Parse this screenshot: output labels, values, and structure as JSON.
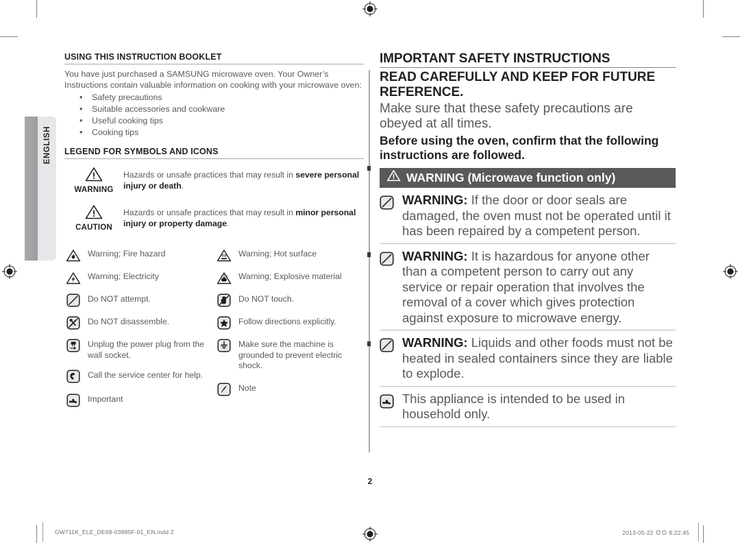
{
  "document": {
    "language_tab": "ENGLISH",
    "page_number": "2",
    "footer_file": "GW711K_ELE_DE68-03895F-01_EN.indd   2",
    "footer_timestamp": "2013-05-22   ＯＯ 8:22:45"
  },
  "left_column": {
    "section1": {
      "heading": "USING THIS INSTRUCTION BOOKLET",
      "paragraph": "You have just purchased a SAMSUNG microwave oven. Your Owner’s Instructions contain valuable information on cooking with your microwave oven:",
      "bullets": [
        "Safety precautions",
        "Suitable accessories and cookware",
        "Useful cooking tips",
        "Cooking tips"
      ]
    },
    "section2": {
      "heading": "LEGEND FOR SYMBOLS AND ICONS",
      "legend_rows": [
        {
          "icon": "warning-triangle-icon",
          "key": "WARNING",
          "text_plain": "Hazards or unsafe practices that may result in ",
          "text_bold": "severe personal injury or death",
          "text_tail": "."
        },
        {
          "icon": "caution-triangle-icon",
          "key": "CAUTION",
          "text_plain": "Hazards or unsafe practices that may result in ",
          "text_bold": "minor personal injury or property damage",
          "text_tail": "."
        }
      ],
      "icons_left": [
        {
          "icon": "fire-hazard-icon",
          "label": "Warning; Fire hazard"
        },
        {
          "icon": "electricity-hazard-icon",
          "label": "Warning; Electricity"
        },
        {
          "icon": "do-not-attempt-icon",
          "label": "Do NOT attempt."
        },
        {
          "icon": "do-not-disassemble-icon",
          "label": "Do NOT disassemble."
        },
        {
          "icon": "unplug-power-icon",
          "label": "Unplug the power plug from the wall socket."
        },
        {
          "icon": "call-service-center-icon",
          "label": "Call the service center for help."
        },
        {
          "icon": "important-hand-icon",
          "label": "Important"
        }
      ],
      "icons_right": [
        {
          "icon": "hot-surface-icon",
          "label": "Warning; Hot surface"
        },
        {
          "icon": "explosive-material-icon",
          "label": "Warning; Explosive material"
        },
        {
          "icon": "do-not-touch-icon",
          "label": "Do NOT touch."
        },
        {
          "icon": "follow-directions-icon",
          "label": "Follow directions explicitly."
        },
        {
          "icon": "grounding-icon",
          "label": "Make sure the machine is grounded to prevent electric shock."
        },
        {
          "icon": "note-pen-icon",
          "label": "Note"
        }
      ]
    }
  },
  "right_column": {
    "title": "IMPORTANT SAFETY INSTRUCTIONS",
    "subtitle": "READ CAREFULLY AND KEEP FOR FUTURE REFERENCE.",
    "plain_line": "Make sure that these safety precautions are obeyed at all times.",
    "bold_line": "Before using the oven, confirm that the following instructions are followed.",
    "warning_bar": {
      "icon": "warning-triangle-icon",
      "label": "WARNING (Microwave function only)"
    },
    "warnings": [
      {
        "icon": "do-not-attempt-icon",
        "lead": "WARNING:",
        "text": " If the door or door seals are damaged, the oven must not be operated until it has been repaired by a competent person."
      },
      {
        "icon": "do-not-attempt-icon",
        "lead": "WARNING:",
        "text": " It is hazardous for anyone other than a competent person to carry out any service or repair operation that involves the removal of a cover which gives protection against exposure to microwave energy."
      },
      {
        "icon": "do-not-attempt-icon",
        "lead": "WARNING:",
        "text": " Liquids and other foods must not be heated in sealed containers since they are liable to explode."
      },
      {
        "icon": "important-hand-icon",
        "lead": "",
        "text": "This appliance is intended to be used in household only."
      }
    ]
  },
  "colors": {
    "body_text": "#58595b",
    "heading_text": "#231f20",
    "warning_bar_bg": "#58595b",
    "rule": "#bcbec0",
    "tab_dark": "#a7a9ac",
    "tab_light": "#e6e7e8",
    "title_underline": "#8d7a86"
  }
}
